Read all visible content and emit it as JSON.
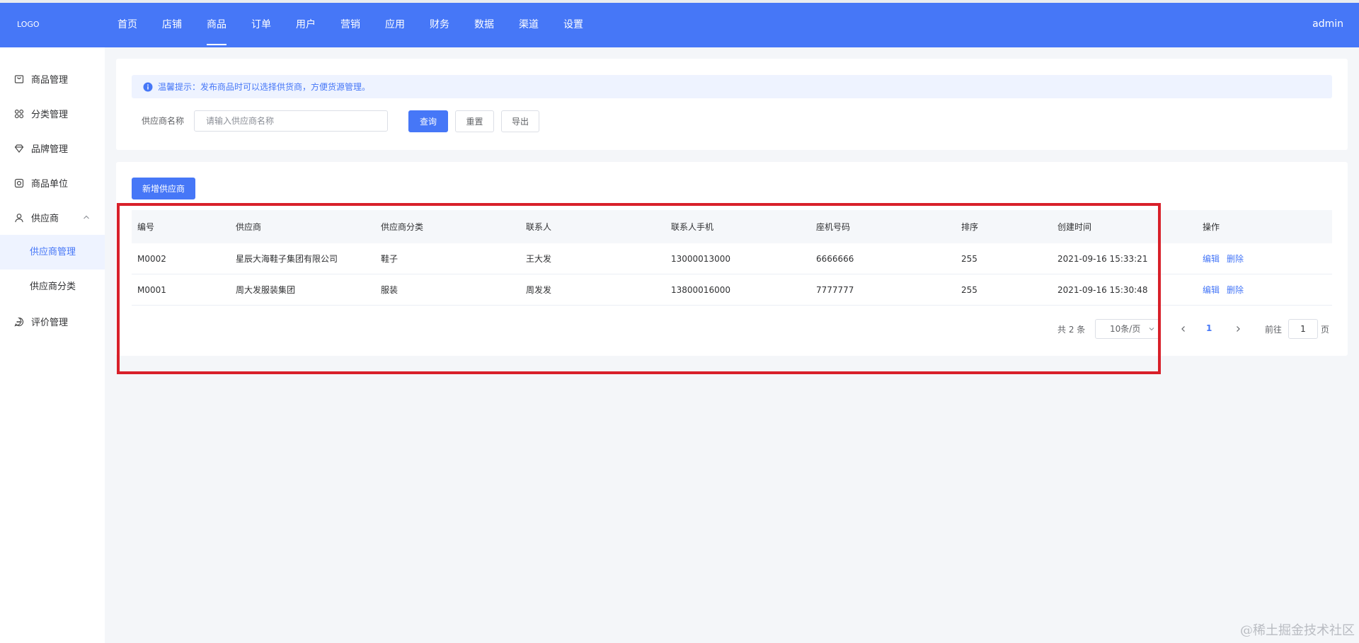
{
  "header": {
    "logo": "LOGO",
    "nav": [
      "首页",
      "店铺",
      "商品",
      "订单",
      "用户",
      "营销",
      "应用",
      "财务",
      "数据",
      "渠道",
      "设置"
    ],
    "active_nav": "商品",
    "user": "admin"
  },
  "sidebar": {
    "items": [
      {
        "label": "商品管理",
        "icon": "bag-icon"
      },
      {
        "label": "分类管理",
        "icon": "grid-icon"
      },
      {
        "label": "品牌管理",
        "icon": "diamond-icon"
      },
      {
        "label": "商品单位",
        "icon": "unit-icon"
      },
      {
        "label": "供应商",
        "icon": "user-icon"
      }
    ],
    "submenu": [
      "供应商管理",
      "供应商分类"
    ],
    "active_submenu": "供应商管理",
    "last_item": {
      "label": "评价管理",
      "icon": "chat-icon"
    }
  },
  "filter": {
    "tip": "温馨提示：发布商品时可以选择供货商，方便货源管理。",
    "label": "供应商名称",
    "placeholder": "请输入供应商名称",
    "query": "查询",
    "reset": "重置",
    "export": "导出"
  },
  "toolbar": {
    "add": "新增供应商"
  },
  "table": {
    "columns": [
      "编号",
      "供应商",
      "供应商分类",
      "联系人",
      "联系人手机",
      "座机号码",
      "排序",
      "创建时间",
      "操作"
    ],
    "rows": [
      [
        "M0002",
        "星辰大海鞋子集团有限公司",
        "鞋子",
        "王大发",
        "13000013000",
        "6666666",
        "255",
        "2021-09-16 15:33:21"
      ],
      [
        "M0001",
        "周大发服装集团",
        "服装",
        "周发发",
        "13800016000",
        "7777777",
        "255",
        "2021-09-16 15:30:48"
      ]
    ],
    "actions": {
      "edit": "编辑",
      "delete": "删除"
    }
  },
  "pagination": {
    "total": "共 2 条",
    "page_size": "10条/页",
    "current_page": "1",
    "goto_label": "前往",
    "goto_value": "1",
    "page_unit": "页"
  },
  "watermark": "@稀土掘金技术社区",
  "colors": {
    "primary": "#4677f7",
    "highlight": "#d8202a"
  }
}
